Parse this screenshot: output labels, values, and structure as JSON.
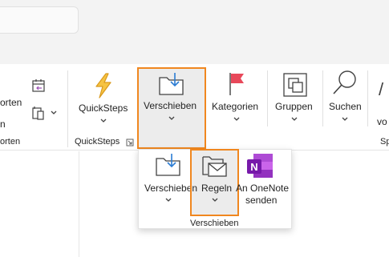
{
  "ribbon": {
    "left_group": {
      "label_sortieren_partial": "orten",
      "label_n_partial": "n",
      "group_label_partial": "orten"
    },
    "quicksteps": {
      "label": "QuickSteps",
      "group_label": "QuickSteps"
    },
    "verschieben": {
      "label": "Verschieben"
    },
    "kategorien": {
      "label": "Kategorien"
    },
    "gruppen": {
      "label": "Gruppen"
    },
    "suchen": {
      "label": "Suchen"
    },
    "right_partial": {
      "label_top": "/",
      "label_mid": "vo",
      "label_bottom": "Sp"
    }
  },
  "flyout": {
    "group_label": "Verschieben",
    "items": [
      {
        "label": "Verschieben"
      },
      {
        "label": "Regeln"
      },
      {
        "label_line1": "An OneNote",
        "label_line2": "senden"
      }
    ]
  },
  "colors": {
    "highlight": "#f0871f",
    "accent_blue": "#2b7cd3",
    "quicksteps_bolt": "#f2b233",
    "flag_red": "#e8485a",
    "onenote_purple": "#7719aa"
  },
  "icons": [
    "reply-calendar-icon",
    "device-dropdown-icon",
    "lightning-icon",
    "move-folder-icon",
    "flag-icon",
    "group-icon",
    "search-icon",
    "rules-envelope-icon",
    "onenote-icon"
  ]
}
